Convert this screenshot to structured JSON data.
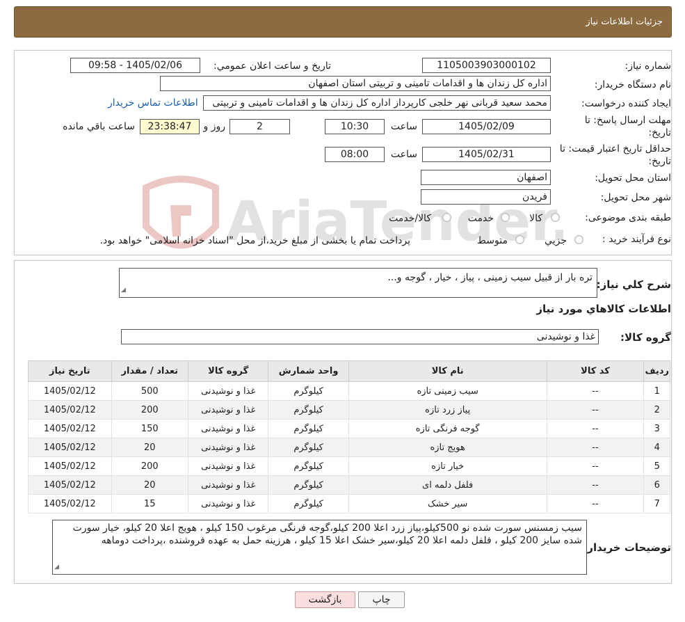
{
  "header": {
    "title": "جزئیات اطلاعات نیاز"
  },
  "form": {
    "need_number_label": "شماره نیاز:",
    "need_number": "1105003903000102",
    "announce_label": "تاريخ و ساعت اعلان عمومي:",
    "announce_value": "1405/02/06 - 09:58",
    "buyer_label": "نام دستگاه خریدار:",
    "buyer_value": "اداره کل زندان ها و اقدامات تامینی و تربیتی استان اصفهان",
    "creator_label": "ایجاد کننده درخواست:",
    "creator_value": "محمد سعید قربانی نهر خلجی کارپرداز اداره کل زندان ها و اقدامات تامینی و تربیتی",
    "contact_link": "اطلاعات تماس خریدار",
    "deadline_label_1": "مهلت ارسال پاسخ: تا",
    "deadline_label_2": "تاریخ:",
    "deadline_date": "1405/02/09",
    "time_label": "ساعت",
    "deadline_time": "10:30",
    "days_value": "2",
    "days_label": "روز و",
    "remaining_time": "23:38:47",
    "remaining_label": "ساعت باقي مانده",
    "validity_label_1": "حداقل تاریخ اعتبار قیمت: تا",
    "validity_label_2": "تاریخ:",
    "validity_date": "1405/02/31",
    "validity_time": "08:00",
    "province_label": "استان محل تحویل:",
    "province_value": "اصفهان",
    "city_label": "شهر محل تحویل:",
    "city_value": "فریدن",
    "category_label": "طبقه بندی موضوعی:",
    "category_options": [
      "کالا",
      "خدمت",
      "کالا/خدمت"
    ],
    "process_label": "نوع فرآیند خرید :",
    "process_options": [
      "جزیي",
      "متوسط"
    ],
    "process_note": "پرداخت تمام یا بخشی از مبلغ خرید،از محل \"اسناد خزانه اسلامی\" خواهد بود."
  },
  "details": {
    "summary_label": "شرح کلي نياز:",
    "summary_value": "تره بار از قبیل سیب زمینی ، پیاز ، خیار ، گوجه و...",
    "goods_info_title": "اطلاعات کالاهاي مورد نياز",
    "goods_group_label": "گروه کالا:",
    "goods_group_value": "غذا و نوشیدنی",
    "table": {
      "headers": [
        "ردیف",
        "کد کالا",
        "نام کالا",
        "واحد شمارش",
        "گروه کالا",
        "تعداد / مقدار",
        "تاریخ نیاز"
      ],
      "rows": [
        [
          "1",
          "--",
          "سیب زمینی تازه",
          "کیلوگرم",
          "غذا و نوشیدنی",
          "500",
          "1405/02/12"
        ],
        [
          "2",
          "--",
          "پیاز زرد تازه",
          "کیلوگرم",
          "غذا و نوشیدنی",
          "200",
          "1405/02/12"
        ],
        [
          "3",
          "--",
          "گوجه فرنگی تازه",
          "کیلوگرم",
          "غذا و نوشیدنی",
          "150",
          "1405/02/12"
        ],
        [
          "4",
          "--",
          "هویج تازه",
          "کیلوگرم",
          "غذا و نوشیدنی",
          "20",
          "1405/02/12"
        ],
        [
          "5",
          "--",
          "خیار تازه",
          "کیلوگرم",
          "غذا و نوشیدنی",
          "200",
          "1405/02/12"
        ],
        [
          "6",
          "--",
          "فلفل دلمه ای",
          "کیلوگرم",
          "غذا و نوشیدنی",
          "20",
          "1405/02/12"
        ],
        [
          "7",
          "--",
          "سیر خشک",
          "کیلوگرم",
          "غذا و نوشیدنی",
          "15",
          "1405/02/12"
        ]
      ]
    },
    "buyer_notes_label": "توضیحات خریدار:",
    "buyer_notes_value": "سیب زمسنس سورت شده نو 500کیلو،پیاز زرد اعلا 200 کیلو،گوجه فرنگی مرغوب 150 کیلو ، هویج اعلا 20 کیلو، خیار سورت شده سایز 200 کیلو ، فلفل دلمه اعلا 20 کیلو،سیر خشک اعلا  15 کیلو ، هرزینه حمل به عهده فروشنده ،پرداخت دوماهه"
  },
  "buttons": {
    "print": "چاپ",
    "back": "بازگشت"
  },
  "watermark_text": "AriaTender.neT"
}
